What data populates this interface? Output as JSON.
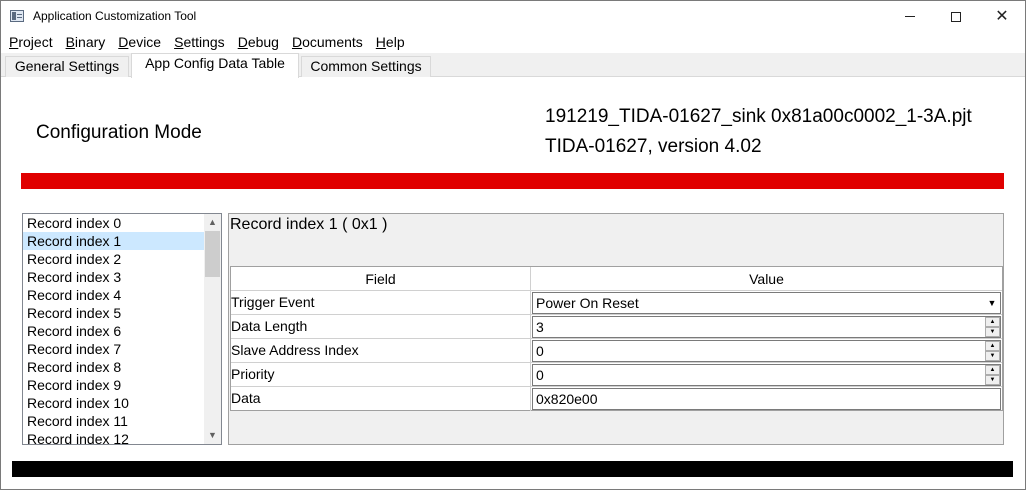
{
  "window": {
    "title": "Application Customization Tool",
    "controls": {
      "minimize_icon": "minimize-icon",
      "maximize_icon": "maximize-icon",
      "close_icon": "close-icon"
    }
  },
  "menu": [
    {
      "label": "Project",
      "mnemonic": "P"
    },
    {
      "label": "Binary",
      "mnemonic": "B"
    },
    {
      "label": "Device",
      "mnemonic": "D"
    },
    {
      "label": "Settings",
      "mnemonic": "S"
    },
    {
      "label": "Debug",
      "mnemonic": "D"
    },
    {
      "label": "Documents",
      "mnemonic": "D"
    },
    {
      "label": "Help",
      "mnemonic": "H"
    }
  ],
  "tabs": [
    {
      "label": "General Settings",
      "active": false
    },
    {
      "label": "App Config Data Table",
      "active": true
    },
    {
      "label": "Common Settings",
      "active": false
    }
  ],
  "header": {
    "mode": "Configuration Mode",
    "project_file": "191219_TIDA-01627_sink 0x81a00c0002_1-3A.pjt",
    "project_version": "TIDA-01627, version 4.02",
    "status_color": "#e00000"
  },
  "records": {
    "items": [
      "Record index 0",
      "Record index 1",
      "Record index 2",
      "Record index 3",
      "Record index 4",
      "Record index 5",
      "Record index 6",
      "Record index 7",
      "Record index 8",
      "Record index 9",
      "Record index 10",
      "Record index 11",
      "Record index 12"
    ],
    "selected_index": 1
  },
  "detail": {
    "title": "Record index 1  ( 0x1 )",
    "columns": {
      "field": "Field",
      "value": "Value"
    },
    "rows": [
      {
        "field": "Trigger Event",
        "value": "Power On Reset",
        "control": "dropdown"
      },
      {
        "field": "Data Length",
        "value": "3",
        "control": "spinner"
      },
      {
        "field": "Slave Address Index",
        "value": "0",
        "control": "spinner"
      },
      {
        "field": "Priority",
        "value": "0",
        "control": "spinner"
      },
      {
        "field": "Data",
        "value": "0x820e00",
        "control": "text"
      }
    ]
  },
  "footer_bar_color": "#000000"
}
